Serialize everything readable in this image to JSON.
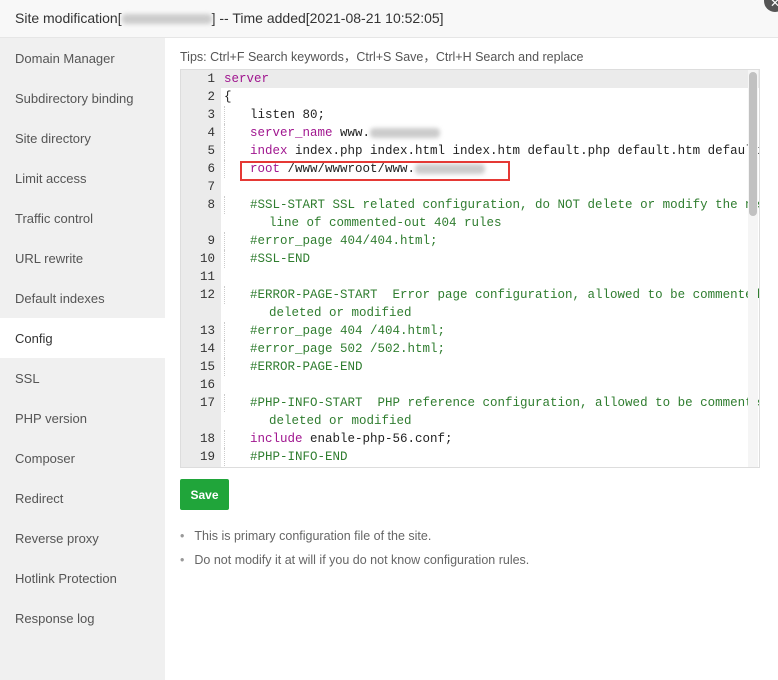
{
  "header": {
    "title_prefix": "Site modification[",
    "title_suffix": "] -- Time added[2021-08-21 10:52:05]",
    "close": "✕"
  },
  "sidebar": {
    "items": [
      "Domain Manager",
      "Subdirectory binding",
      "Site directory",
      "Limit access",
      "Traffic control",
      "URL rewrite",
      "Default indexes",
      "Config",
      "SSL",
      "PHP version",
      "Composer",
      "Redirect",
      "Reverse proxy",
      "Hotlink Protection",
      "Response log"
    ],
    "active": "Config"
  },
  "tips": "Tips: Ctrl+F Search keywords，Ctrl+S Save，Ctrl+H Search and replace",
  "editor": {
    "lines": [
      {
        "n": "1",
        "g": 0,
        "s": [
          [
            "kw",
            "server"
          ]
        ]
      },
      {
        "n": "2",
        "g": 0,
        "s": [
          [
            "",
            "{"
          ]
        ]
      },
      {
        "n": "3",
        "g": 1,
        "s": [
          [
            "",
            "listen 80;"
          ]
        ]
      },
      {
        "n": "4",
        "g": 1,
        "s": [
          [
            "kw",
            "server_name"
          ],
          [
            "",
            " www."
          ]
        ],
        "blur": true
      },
      {
        "n": "5",
        "g": 1,
        "s": [
          [
            "kw",
            "index"
          ],
          [
            "",
            " index.php index.html index.htm default.php default.htm default.html;"
          ]
        ]
      },
      {
        "n": "6",
        "g": 1,
        "s": [
          [
            "kw",
            "root"
          ],
          [
            "",
            " /www/wwwroot/www."
          ]
        ],
        "blur": true
      },
      {
        "n": "7",
        "g": 0,
        "s": []
      },
      {
        "n": "8",
        "g": 1,
        "s": [
          [
            "cm",
            "#SSL-START SSL related configuration, do NOT delete or modify the next"
          ]
        ]
      },
      {
        "n": "",
        "g": 0,
        "s": [
          [
            "cm",
            "      line of commented-out 404 rules"
          ]
        ]
      },
      {
        "n": "9",
        "g": 1,
        "s": [
          [
            "cm",
            "#error_page 404/404.html;"
          ]
        ]
      },
      {
        "n": "10",
        "g": 1,
        "s": [
          [
            "cm",
            "#SSL-END"
          ]
        ]
      },
      {
        "n": "11",
        "g": 0,
        "s": []
      },
      {
        "n": "12",
        "g": 1,
        "s": [
          [
            "cm",
            "#ERROR-PAGE-START  Error page configuration, allowed to be commented,"
          ]
        ]
      },
      {
        "n": "",
        "g": 0,
        "s": [
          [
            "cm",
            "      deleted or modified"
          ]
        ]
      },
      {
        "n": "13",
        "g": 1,
        "s": [
          [
            "cm",
            "#error_page 404 /404.html;"
          ]
        ]
      },
      {
        "n": "14",
        "g": 1,
        "s": [
          [
            "cm",
            "#error_page 502 /502.html;"
          ]
        ]
      },
      {
        "n": "15",
        "g": 1,
        "s": [
          [
            "cm",
            "#ERROR-PAGE-END"
          ]
        ]
      },
      {
        "n": "16",
        "g": 0,
        "s": []
      },
      {
        "n": "17",
        "g": 1,
        "s": [
          [
            "cm",
            "#PHP-INFO-START  PHP reference configuration, allowed to be commented,"
          ]
        ]
      },
      {
        "n": "",
        "g": 0,
        "s": [
          [
            "cm",
            "      deleted or modified"
          ]
        ]
      },
      {
        "n": "18",
        "g": 1,
        "s": [
          [
            "kw",
            "include"
          ],
          [
            "",
            " enable-php-56.conf;"
          ]
        ]
      },
      {
        "n": "19",
        "g": 1,
        "s": [
          [
            "cm",
            "#PHP-INFO-END"
          ]
        ]
      }
    ]
  },
  "save_label": "Save",
  "notes": [
    "This is primary configuration file of the site.",
    "Do not modify it at will if you do not know configuration rules."
  ]
}
